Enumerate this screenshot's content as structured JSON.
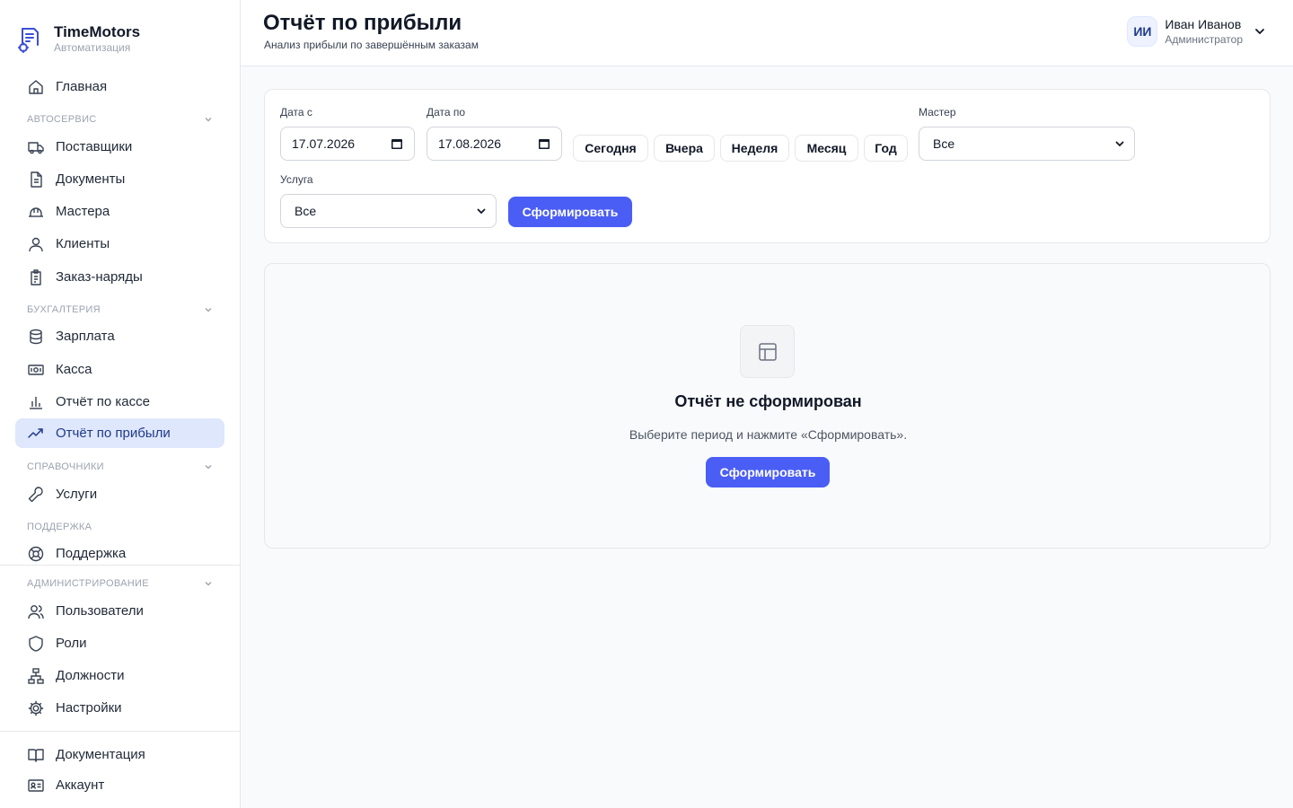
{
  "brand": {
    "name": "TimeMotors",
    "subtitle": "Автоматизация"
  },
  "nav": {
    "home": "Главная",
    "sections": {
      "autoservice": "АВТОСЕРВИС",
      "accounting": "БУХГАЛТЕРИЯ",
      "references": "СПРАВОЧНИКИ",
      "support": "ПОДДЕРЖКА",
      "admin": "АДМИНИСТРИРОВАНИЕ"
    },
    "items": {
      "suppliers": "Поставщики",
      "documents": "Документы",
      "masters": "Мастера",
      "clients": "Клиенты",
      "orders": "Заказ-наряды",
      "salary": "Зарплата",
      "cash": "Касса",
      "cash_report": "Отчёт по кассе",
      "profit_report": "Отчёт по прибыли",
      "services": "Услуги",
      "support": "Поддержка",
      "users": "Пользователи",
      "roles": "Роли",
      "positions": "Должности",
      "settings": "Настройки",
      "docs": "Документация",
      "account": "Аккаунт"
    },
    "active": "profit_report"
  },
  "header": {
    "title": "Отчёт по прибыли",
    "subtitle": "Анализ прибыли по завершённым заказам"
  },
  "user": {
    "initials": "ИИ",
    "name": "Иван Иванов",
    "role": "Администратор"
  },
  "filters": {
    "date_from_label": "Дата с",
    "date_from": "17.07.2026",
    "date_to_label": "Дата по",
    "date_to": "17.08.2026",
    "quick": {
      "today": "Сегодня",
      "yesterday": "Вчера",
      "week": "Неделя",
      "month": "Месяц",
      "year": "Год"
    },
    "master_label": "Мастер",
    "master_value": "Все",
    "service_label": "Услуга",
    "service_value": "Все",
    "submit": "Сформировать"
  },
  "empty_state": {
    "title": "Отчёт не сформирован",
    "text": "Выберите период и нажмите «Сформировать».",
    "button": "Сформировать"
  },
  "colors": {
    "accent": "#4a5ef5",
    "active_bg": "#dfe7fc",
    "border": "#e5e7eb"
  }
}
